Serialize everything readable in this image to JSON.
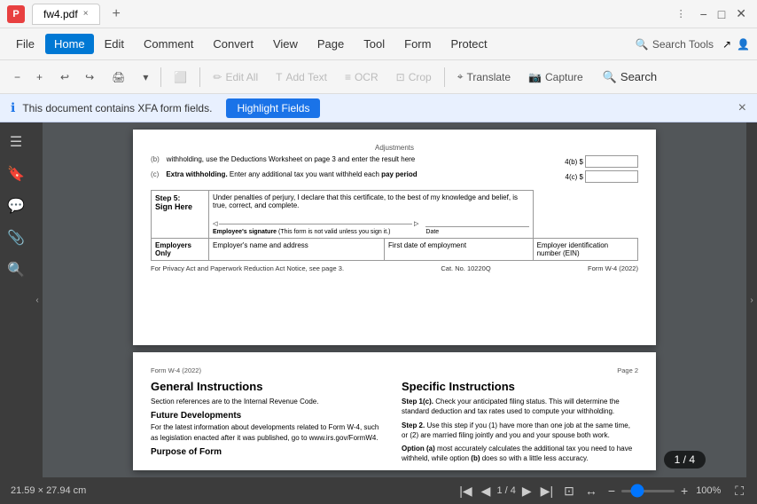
{
  "titleBar": {
    "appName": "fw4.pdf",
    "tabLabel": "fw4.pdf",
    "closeTab": "×",
    "addTab": "+"
  },
  "menuBar": {
    "items": [
      "File",
      "Edit",
      "Comment",
      "Convert",
      "View",
      "Page",
      "Tool",
      "Form",
      "Protect"
    ],
    "activeItem": "Home",
    "searchTools": "Search Tools"
  },
  "toolbar": {
    "zoom_out": "−",
    "zoom_in": "+",
    "undo": "↩",
    "redo": "↪",
    "print": "🖨",
    "editAll": "Edit All",
    "addText": "Add Text",
    "ocr": "OCR",
    "crop": "Crop",
    "translate": "Translate",
    "capture": "Capture",
    "search": "Search"
  },
  "notification": {
    "icon": "ℹ",
    "text": "This document contains XFA form fields.",
    "buttonLabel": "Highlight Fields",
    "closeIcon": "×"
  },
  "document": {
    "page1": {
      "adjustments": "Adjustments",
      "row4b": {
        "label": "(b)",
        "text": "Deductions Worksheet on page 3 and enter the result here"
      },
      "row4c": {
        "label": "(c)",
        "boldText": "Extra withholding.",
        "text": "Enter any additional tax you want withheld each",
        "boldText2": "pay period"
      },
      "step5": {
        "stepNum": "Step 5:",
        "label": "Sign Here",
        "desc": "Under penalties of perjury, I declare that this certificate, to the best of my knowledge and belief, is true, correct, and complete.",
        "sigLabel": "Employee's signature",
        "sigNote": "(This form is not valid unless you sign it.)",
        "dateLabel": "Date"
      },
      "employers": {
        "label": "Employers Only",
        "col1": "Employer's name and address",
        "col2": "First date of employment",
        "col3": "Employer identification number (EIN)"
      },
      "privacy": {
        "left": "For Privacy Act and Paperwork Reduction Act Notice, see page 3.",
        "center": "Cat. No. 10220Q",
        "right": "Form W-4 (2022)"
      }
    },
    "page2": {
      "pageLabel": "Form W-4 (2022)",
      "pageNum": "Page 2",
      "generalTitle": "General Instructions",
      "generalText": "Section references are to the Internal Revenue Code.",
      "futureTitle": "Future Developments",
      "futureText": "For the latest information about developments related to Form W-4, such as legislation enacted after it was published, go to www.irs.gov/FormW4.",
      "purposeTitle": "Purpose of Form",
      "specificTitle": "Specific Instructions",
      "step1c": {
        "ref": "Step 1(c).",
        "text": "Check your anticipated filing status. This will determine the standard deduction and tax rates used to compute your withholding."
      },
      "step2": {
        "ref": "Step 2.",
        "text": "Use this step if you (1) have more than one job at the same time, or (2) are married filing jointly and you and your spouse both work."
      },
      "optionA": {
        "ref": "Option (a)",
        "text": "most accurately calculates the additional tax you need to have withheld, while option"
      },
      "optionB": {
        "ref": "(b)",
        "text": "does so with a little less accuracy."
      }
    }
  },
  "bottomBar": {
    "dimensions": "21.59 × 27.94 cm",
    "currentPage": "1",
    "totalPages": "4",
    "pageDisplay": "1 / 4",
    "zoomLevel": "100%",
    "pageIndicator": "1 / 4"
  },
  "sidebar": {
    "icons": [
      "☰",
      "🔖",
      "💬",
      "📎",
      "🔍"
    ]
  }
}
